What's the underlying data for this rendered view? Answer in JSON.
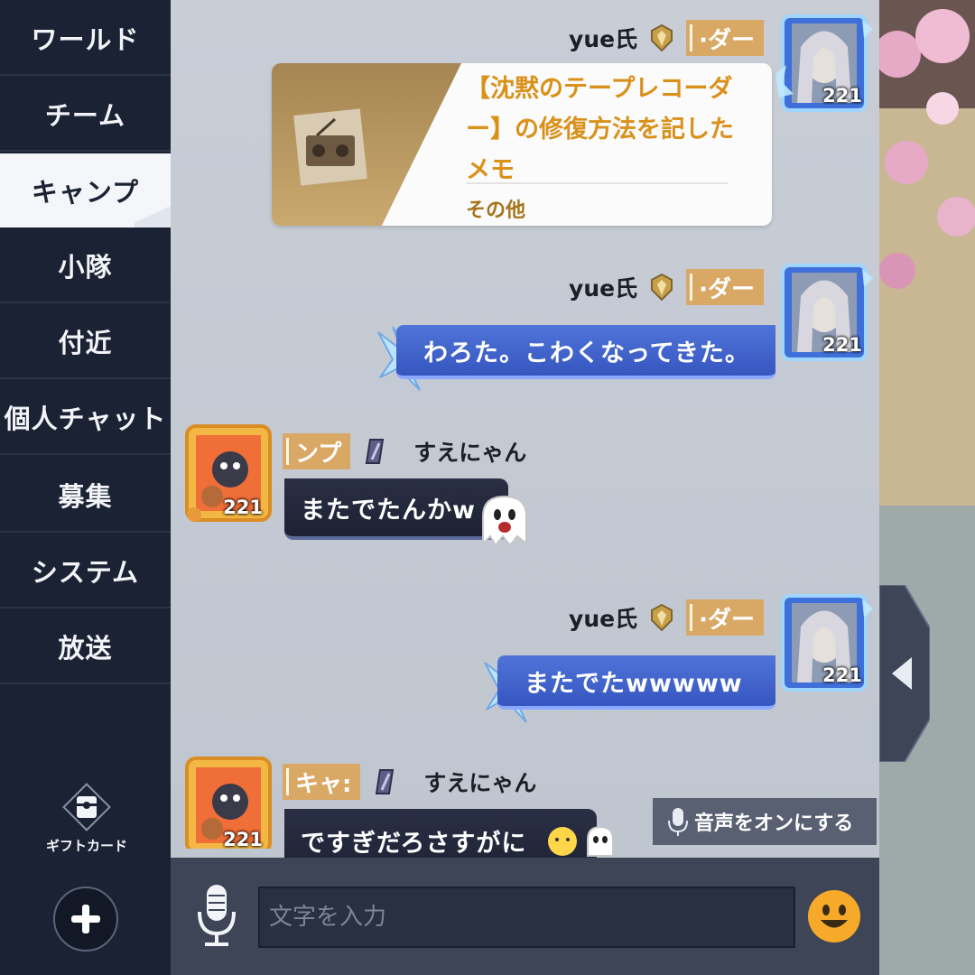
{
  "sidebar": {
    "items": [
      {
        "label": "ワールド",
        "active": false
      },
      {
        "label": "チーム",
        "active": false
      },
      {
        "label": "キャンプ",
        "active": true
      },
      {
        "label": "小隊",
        "active": false
      },
      {
        "label": "付近",
        "active": false
      },
      {
        "label": "個人チャット",
        "active": false
      },
      {
        "label": "募集",
        "active": false
      },
      {
        "label": "システム",
        "active": false
      },
      {
        "label": "放送",
        "active": false
      }
    ],
    "gift_card_label": "ギフトカード"
  },
  "messages": [
    {
      "sender": "yue氏",
      "rank": "·ダー",
      "level": "221",
      "type": "item",
      "item_title": "【沈黙のテープレコーダー】の修復方法を記したメモ",
      "item_category": "その他"
    },
    {
      "sender": "yue氏",
      "rank": "·ダー",
      "level": "221",
      "type": "text",
      "text": "わろた。こわくなってきた。"
    },
    {
      "sender": "すえにゃん",
      "rank": "ンプ",
      "level": "221",
      "type": "text",
      "text": "またでたんかw"
    },
    {
      "sender": "yue氏",
      "rank": "·ダー",
      "level": "221",
      "type": "text",
      "text": "またでたwwwww"
    },
    {
      "sender": "すえにゃん",
      "rank": "キャ:",
      "level": "221",
      "type": "text",
      "text": "ですぎだろさすがに"
    }
  ],
  "voice_toggle_label": "音声をオンにする",
  "input": {
    "placeholder": "文字を入力"
  },
  "colors": {
    "sidebar_bg": "#1b2233",
    "chat_bg": "#c4cad3",
    "blue_bubble": "#3f63cc",
    "item_title": "#d9911a",
    "rank_badge": "#d9a864"
  }
}
